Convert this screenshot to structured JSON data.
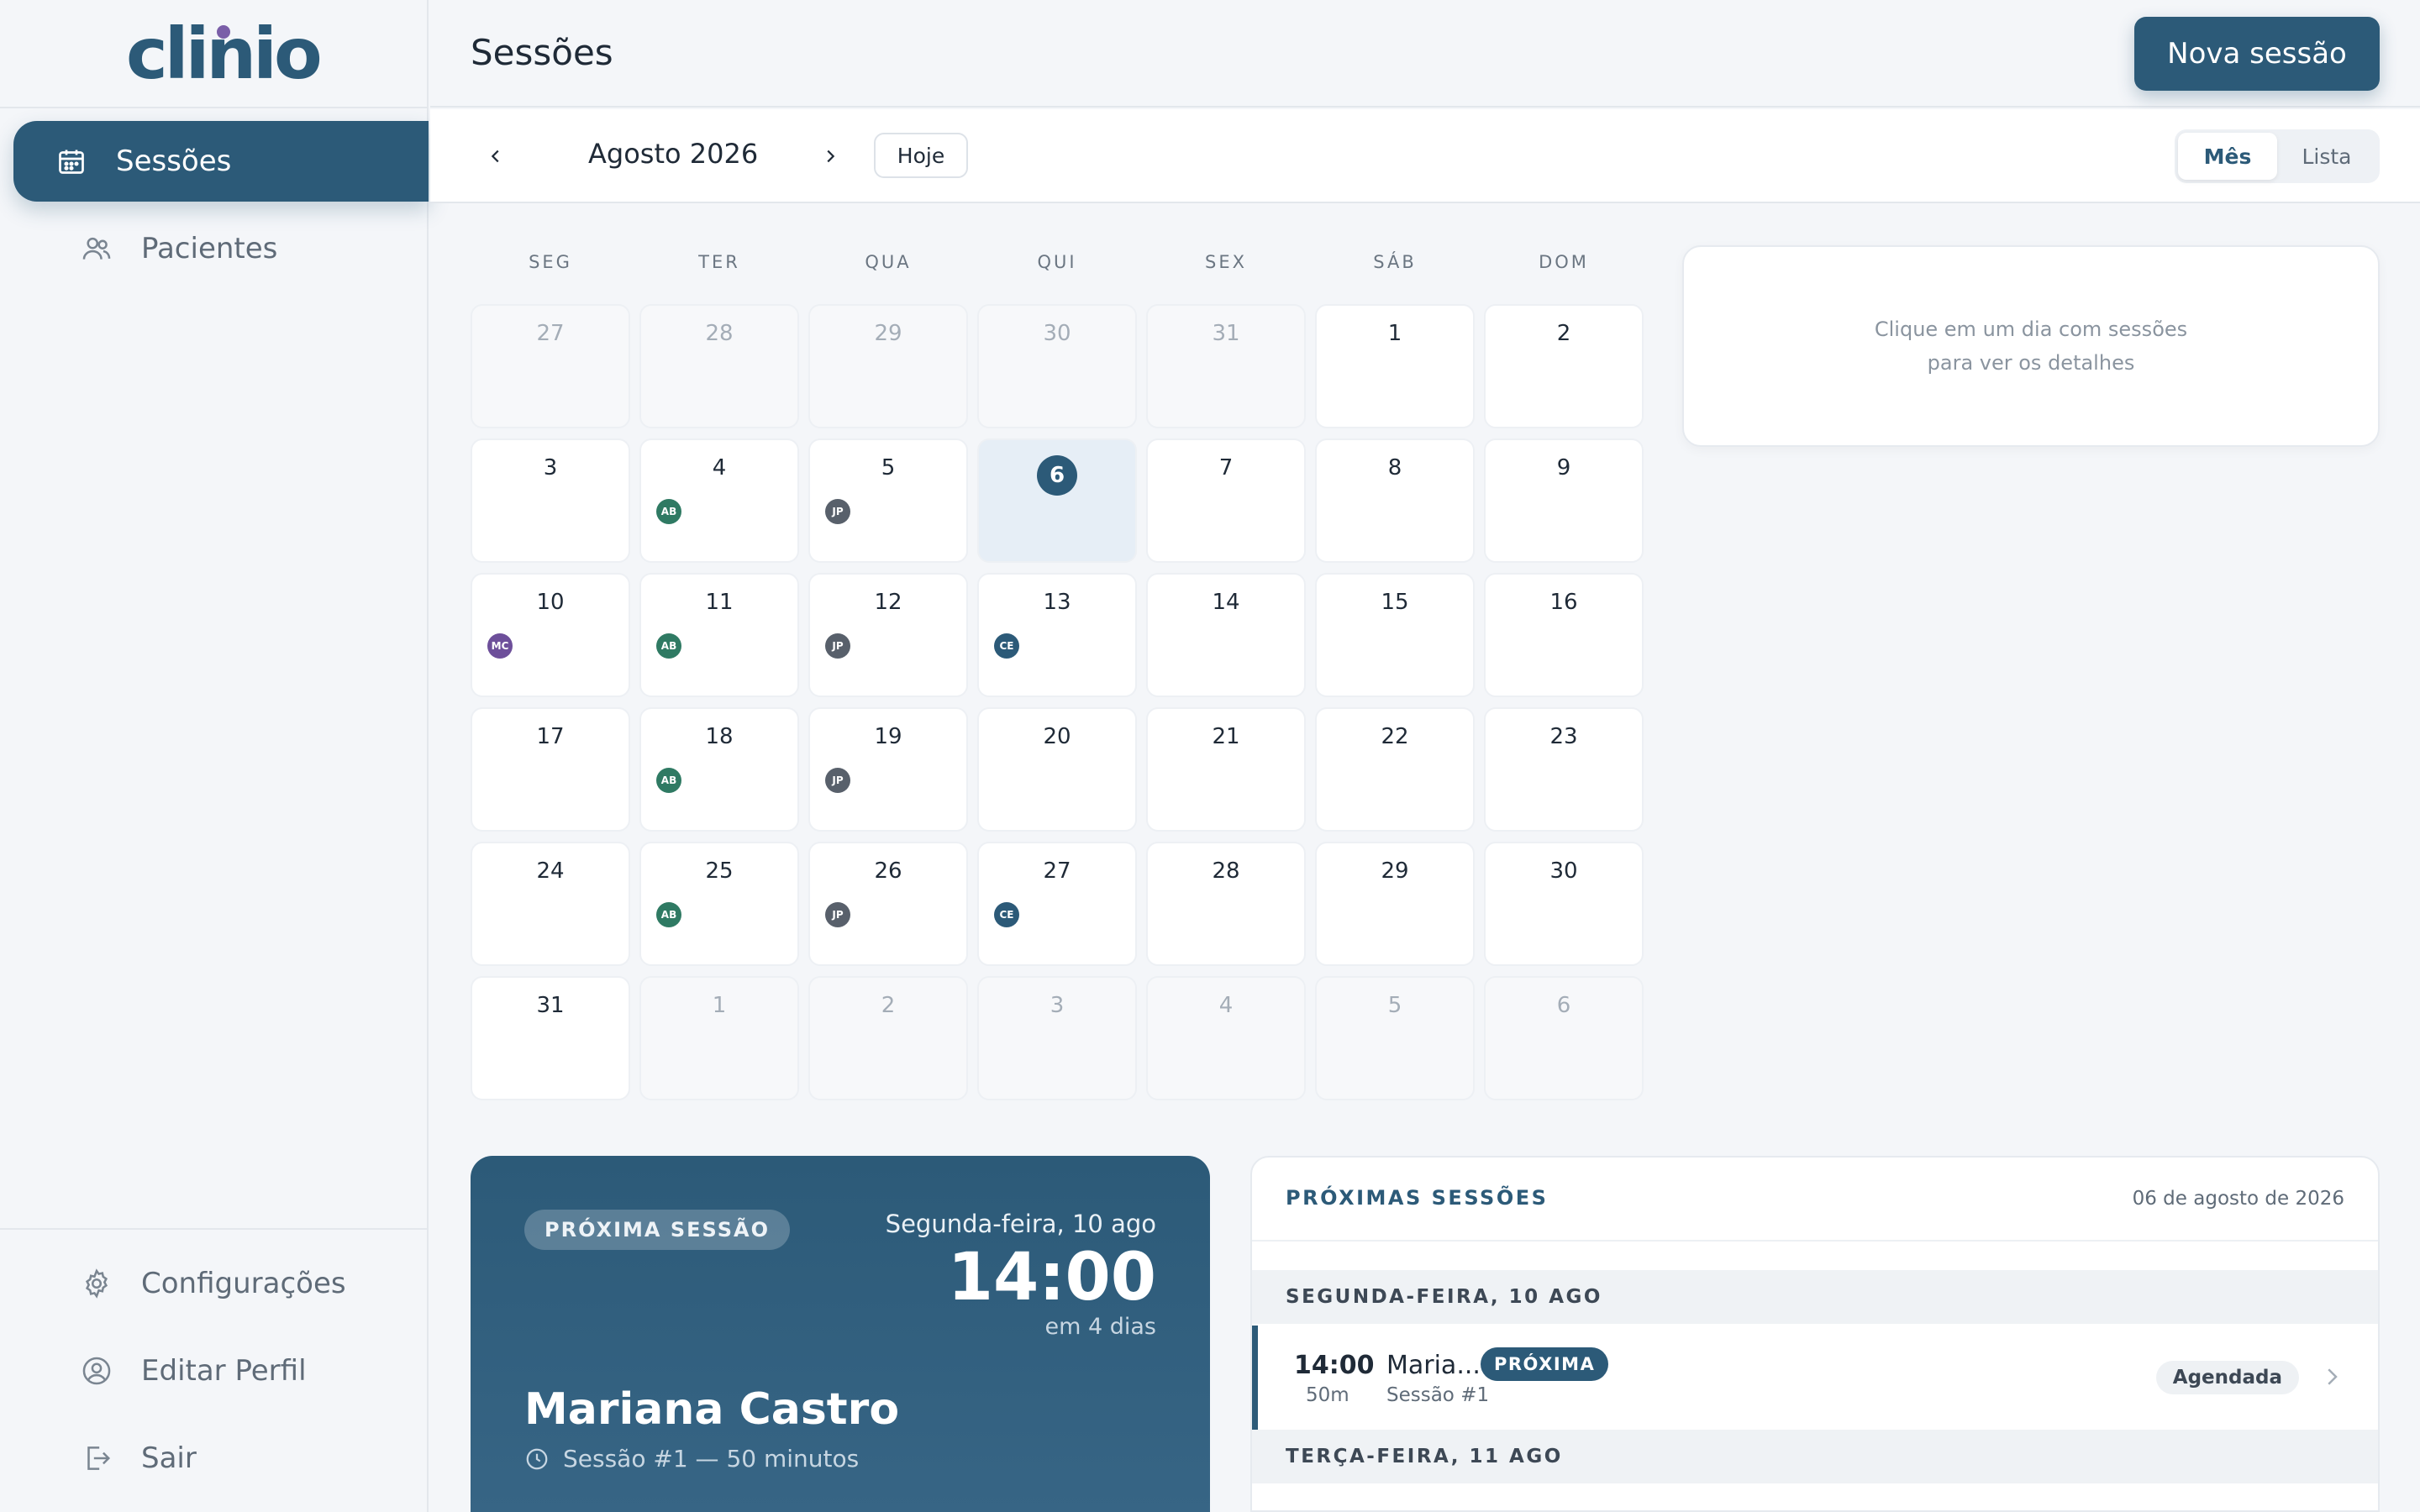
{
  "app": {
    "logo_text": "clinio"
  },
  "sidebar": {
    "items": [
      {
        "label": "Sessões",
        "icon": "calendar-icon",
        "active": true
      },
      {
        "label": "Pacientes",
        "icon": "users-icon",
        "active": false
      }
    ],
    "footer_items": [
      {
        "label": "Configurações",
        "icon": "gear-icon"
      },
      {
        "label": "Editar Perfil",
        "icon": "user-circle-icon"
      },
      {
        "label": "Sair",
        "icon": "logout-icon"
      }
    ]
  },
  "header": {
    "title": "Sessões",
    "new_session_label": "Nova sessão"
  },
  "calendar": {
    "month_label": "Agosto 2026",
    "today_label": "Hoje",
    "view_options": [
      "Mês",
      "Lista"
    ],
    "active_view": "Mês",
    "weekdays": [
      "SEG",
      "TER",
      "QUA",
      "QUI",
      "SEX",
      "SÁB",
      "DOM"
    ],
    "weeks": [
      [
        {
          "d": "27",
          "m": true
        },
        {
          "d": "28",
          "m": true
        },
        {
          "d": "29",
          "m": true
        },
        {
          "d": "30",
          "m": true
        },
        {
          "d": "31",
          "m": true
        },
        {
          "d": "1"
        },
        {
          "d": "2"
        }
      ],
      [
        {
          "d": "3"
        },
        {
          "d": "4",
          "chip": "AB"
        },
        {
          "d": "5",
          "chip": "JP"
        },
        {
          "d": "6",
          "today": true
        },
        {
          "d": "7"
        },
        {
          "d": "8"
        },
        {
          "d": "9"
        }
      ],
      [
        {
          "d": "10",
          "chip": "MC"
        },
        {
          "d": "11",
          "chip": "AB"
        },
        {
          "d": "12",
          "chip": "JP"
        },
        {
          "d": "13",
          "chip": "CE"
        },
        {
          "d": "14"
        },
        {
          "d": "15"
        },
        {
          "d": "16"
        }
      ],
      [
        {
          "d": "17"
        },
        {
          "d": "18",
          "chip": "AB"
        },
        {
          "d": "19",
          "chip": "JP"
        },
        {
          "d": "20"
        },
        {
          "d": "21"
        },
        {
          "d": "22"
        },
        {
          "d": "23"
        }
      ],
      [
        {
          "d": "24"
        },
        {
          "d": "25",
          "chip": "AB"
        },
        {
          "d": "26",
          "chip": "JP"
        },
        {
          "d": "27",
          "chip": "CE"
        },
        {
          "d": "28"
        },
        {
          "d": "29"
        },
        {
          "d": "30"
        }
      ],
      [
        {
          "d": "31"
        },
        {
          "d": "1",
          "m": true
        },
        {
          "d": "2",
          "m": true
        },
        {
          "d": "3",
          "m": true
        },
        {
          "d": "4",
          "m": true
        },
        {
          "d": "5",
          "m": true
        },
        {
          "d": "6",
          "m": true
        }
      ]
    ],
    "chip_colors": {
      "AB": "#2f7a63",
      "JP": "#58606b",
      "MC": "#6d4f9a",
      "CE": "#2c5a78"
    }
  },
  "details_panel": {
    "line1": "Clique em um dia com sessões",
    "line2": "para ver os detalhes"
  },
  "next_session": {
    "badge": "PRÓXIMA SESSÃO",
    "date": "Segunda-feira, 10 ago",
    "time": "14:00",
    "relative": "em 4 dias",
    "patient": "Mariana Castro",
    "meta": "Sessão #1 — 50 minutos"
  },
  "upcoming": {
    "title": "PRÓXIMAS SESSÕES",
    "date": "06 de agosto de 2026",
    "groups": [
      {
        "day": "SEGUNDA-FEIRA, 10 AGO"
      },
      {
        "day": "TERÇA-FEIRA, 11 AGO"
      }
    ],
    "row": {
      "time": "14:00",
      "duration": "50m",
      "patient": "Maria...",
      "session": "Sessão #1",
      "tag": "PRÓXIMA",
      "status": "Agendada"
    }
  },
  "colors": {
    "primary": "#2c5a78",
    "logo_dot": "#7a5ea8"
  }
}
